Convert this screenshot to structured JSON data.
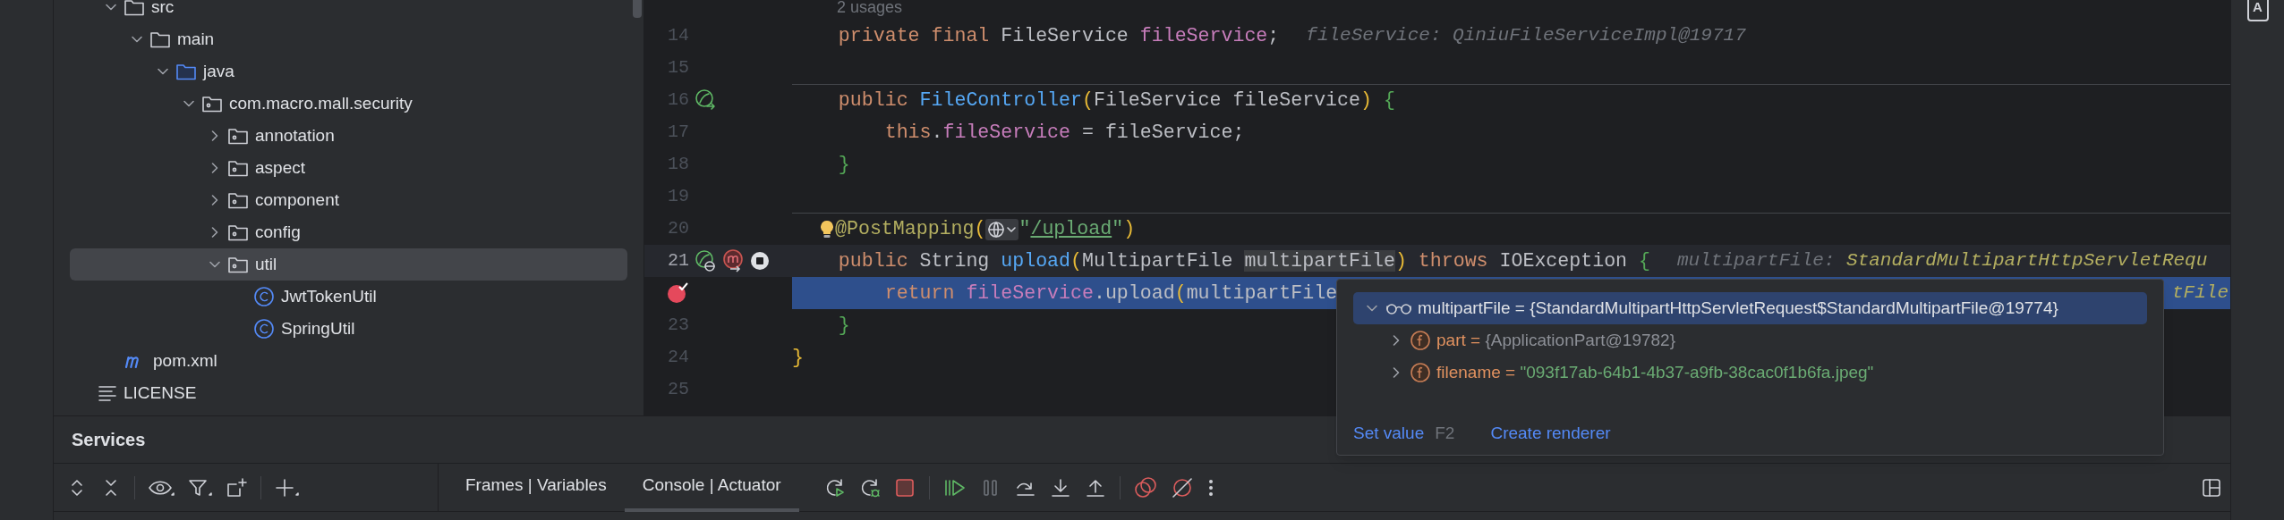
{
  "project_tree": [
    {
      "children": [
        {
          "label": "src",
          "kind": "folder",
          "expanded": true,
          "selected": false,
          "children": [
            {
              "label": "main",
              "kind": "folder",
              "expanded": true,
              "selected": false,
              "children": [
                {
                  "label": "java",
                  "kind": "source-folder",
                  "expanded": true,
                  "selected": false,
                  "children": [
                    {
                      "label": "com.macro.mall.security",
                      "kind": "package",
                      "expanded": true,
                      "selected": false,
                      "children": [
                        {
                          "label": "annotation",
                          "kind": "package",
                          "expanded": false,
                          "selected": false
                        },
                        {
                          "label": "aspect",
                          "kind": "package",
                          "expanded": false,
                          "selected": false
                        },
                        {
                          "label": "component",
                          "kind": "package",
                          "expanded": false,
                          "selected": false
                        },
                        {
                          "label": "config",
                          "kind": "package",
                          "expanded": false,
                          "selected": false
                        },
                        {
                          "label": "util",
                          "kind": "package",
                          "expanded": true,
                          "selected": true,
                          "children": [
                            {
                              "label": "JwtTokenUtil",
                              "kind": "class",
                              "selected": false
                            },
                            {
                              "label": "SpringUtil",
                              "kind": "class",
                              "selected": false
                            }
                          ]
                        }
                      ]
                    }
                  ]
                }
              ]
            }
          ]
        },
        {
          "label": "pom.xml",
          "kind": "maven",
          "selected": false
        }
      ]
    },
    {
      "label": "LICENSE",
      "kind": "text",
      "selected": false
    }
  ],
  "editor": {
    "usages": "2 usages",
    "lines": [
      {
        "number": "14",
        "kind": "plain",
        "separator_above": false,
        "parts": [
          {
            "kind": "code",
            "tokens": [
              {
                "text": "    private final ",
                "kind": "kw"
              },
              {
                "text": "FileService ",
                "kind": "plain"
              },
              {
                "text": "fileService",
                "kind": "field"
              },
              {
                "text": ";",
                "kind": "plain"
              }
            ]
          },
          {
            "kind": "hint",
            "label": "fileService: QiniuFileServiceImpl@19717"
          }
        ]
      },
      {
        "number": "15",
        "kind": "plain",
        "separator_above": false
      },
      {
        "number": "16",
        "kind": "plain",
        "separator_above": true,
        "gutter": [
          {
            "kind": "bean"
          }
        ],
        "parts": [
          {
            "kind": "code",
            "tokens": [
              {
                "text": "    public ",
                "kind": "kw"
              },
              {
                "text": "FileController",
                "kind": "method"
              },
              {
                "text": "(",
                "kind": "bracket-yellow"
              },
              {
                "text": "FileService fileService",
                "kind": "plain"
              },
              {
                "text": ") ",
                "kind": "bracket-yellow"
              },
              {
                "text": "{",
                "kind": "bracket-green"
              }
            ]
          }
        ]
      },
      {
        "number": "17",
        "kind": "plain",
        "separator_above": false,
        "parts": [
          {
            "kind": "code",
            "tokens": [
              {
                "text": "        this",
                "kind": "kw"
              },
              {
                "text": ".",
                "kind": "plain"
              },
              {
                "text": "fileService",
                "kind": "field"
              },
              {
                "text": " = fileService;",
                "kind": "plain"
              }
            ]
          }
        ]
      },
      {
        "number": "18",
        "kind": "plain",
        "separator_above": false,
        "parts": [
          {
            "kind": "code",
            "tokens": [
              {
                "text": "    }",
                "kind": "bracket-green"
              }
            ]
          }
        ]
      },
      {
        "number": "19",
        "kind": "plain",
        "separator_above": false
      },
      {
        "number": "20",
        "kind": "plain",
        "separator_above": true,
        "parts": [
          {
            "kind": "bulb"
          },
          {
            "kind": "code",
            "tokens": [
              {
                "text": "@PostMapping",
                "kind": "annotation"
              },
              {
                "text": "(",
                "kind": "bracket-yellow"
              }
            ]
          },
          {
            "kind": "url-icon"
          },
          {
            "kind": "code",
            "tokens": [
              {
                "text": "\"",
                "kind": "string"
              },
              {
                "text": "/upload",
                "kind": "url"
              },
              {
                "text": "\"",
                "kind": "string"
              },
              {
                "text": ")",
                "kind": "bracket-yellow"
              }
            ]
          }
        ]
      },
      {
        "number": "21",
        "kind": "current",
        "separator_above": false,
        "gutter": [
          {
            "kind": "bean-web"
          },
          {
            "kind": "mapping"
          },
          {
            "kind": "stop"
          }
        ],
        "parts": [
          {
            "kind": "code",
            "tokens": [
              {
                "text": "    public ",
                "kind": "kw"
              },
              {
                "text": "String ",
                "kind": "plain"
              },
              {
                "text": "upload",
                "kind": "method"
              },
              {
                "text": "(",
                "kind": "bracket-yellow"
              },
              {
                "text": "MultipartFile ",
                "kind": "plain"
              },
              {
                "text": "multipartFile",
                "kind": "highlight"
              },
              {
                "text": ")",
                "kind": "bracket-yellow"
              },
              {
                "text": " throws ",
                "kind": "kw"
              },
              {
                "text": "IOException ",
                "kind": "plain"
              },
              {
                "text": "{",
                "kind": "bracket-green"
              }
            ]
          },
          {
            "kind": "hint",
            "label": "multipartFile:",
            "value": "StandardMultipartHttpServletRequ"
          }
        ]
      },
      {
        "kind": "execution",
        "separator_above": false,
        "gutter": [
          {
            "kind": "breakpoint"
          }
        ],
        "parts": [
          {
            "kind": "code",
            "tokens": [
              {
                "text": "        return ",
                "kind": "kw"
              },
              {
                "text": "fileService",
                "kind": "field"
              },
              {
                "text": ".upload",
                "kind": "plain"
              },
              {
                "text": "(",
                "kind": "bracket-yellow"
              },
              {
                "text": "multipartFile",
                "kind": "plain"
              }
            ]
          },
          {
            "kind": "trailing",
            "text": "tFile"
          }
        ]
      },
      {
        "number": "23",
        "kind": "plain",
        "separator_above": false,
        "parts": [
          {
            "kind": "code",
            "tokens": [
              {
                "text": "    }",
                "kind": "bracket-green"
              }
            ]
          }
        ]
      },
      {
        "number": "24",
        "kind": "plain",
        "separator_above": false,
        "parts": [
          {
            "kind": "code",
            "tokens": [
              {
                "text": "}",
                "kind": "bracket-yellow"
              }
            ]
          }
        ]
      },
      {
        "number": "25",
        "kind": "plain",
        "separator_above": false
      }
    ]
  },
  "debug_popup": {
    "rows": [
      {
        "label": "multipartFile =",
        "value": {
          "text": "{StandardMultipartHttpServletRequest$StandardMultipartFile@19774}",
          "kind": "plain"
        },
        "kind": "watch",
        "expanded": true,
        "selected": true,
        "children": [
          {
            "label": "part =",
            "value": {
              "text": "{ApplicationPart@19782}",
              "kind": "object"
            },
            "kind": "field",
            "expanded": false,
            "selected": false
          },
          {
            "label": "filename =",
            "value": {
              "text": "\"093f17ab-64b1-4b37-a9fb-38cac0f1b6fa.jpeg\"",
              "kind": "string"
            },
            "kind": "field",
            "expanded": false,
            "selected": false
          }
        ]
      }
    ],
    "actions": [
      {
        "label": "Set value",
        "shortcut": "F2"
      },
      {
        "label": "Create renderer"
      }
    ]
  },
  "services": {
    "title": "Services",
    "tabs": [
      {
        "label": "Frames | Variables",
        "selected": false
      },
      {
        "label": "Console | Actuator",
        "selected": true
      }
    ]
  },
  "right_stripe": {
    "badge": "A"
  }
}
